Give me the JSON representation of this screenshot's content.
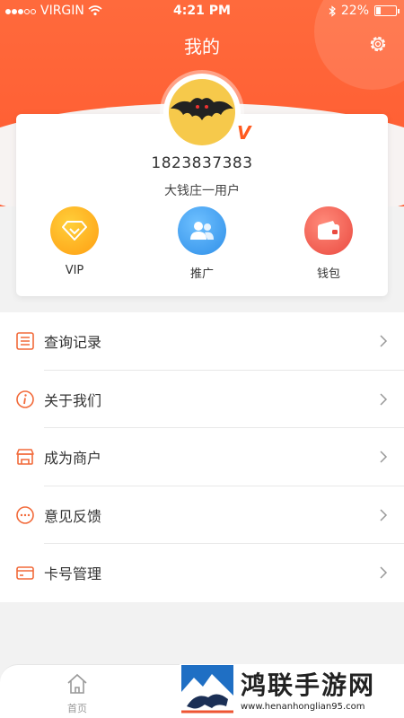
{
  "status": {
    "carrier": "VIRGIN",
    "time": "4:21 PM",
    "battery": "22%",
    "battery_level": 0.22
  },
  "header": {
    "title": "我的"
  },
  "profile": {
    "phone": "1823837383",
    "username": "大钱庄一用户",
    "badge": "V"
  },
  "quick_actions": [
    {
      "label": "VIP",
      "icon": "diamond-icon",
      "color": "#ffb21a"
    },
    {
      "label": "推广",
      "icon": "users-icon",
      "color": "#3a9df0"
    },
    {
      "label": "钱包",
      "icon": "wallet-icon",
      "color": "#f05a50"
    }
  ],
  "menu": [
    {
      "label": "查询记录",
      "icon": "list-icon"
    },
    {
      "label": "关于我们",
      "icon": "info-icon"
    },
    {
      "label": "成为商户",
      "icon": "store-icon"
    },
    {
      "label": "意见反馈",
      "icon": "chat-icon"
    },
    {
      "label": "卡号管理",
      "icon": "card-icon"
    }
  ],
  "tabbar": {
    "home_label": "首页"
  },
  "watermark": {
    "title": "鸿联手游网",
    "url": "www.henanhonglian95.com"
  },
  "colors": {
    "accent": "#ff5a30",
    "menu_icon": "#f26a3a"
  }
}
